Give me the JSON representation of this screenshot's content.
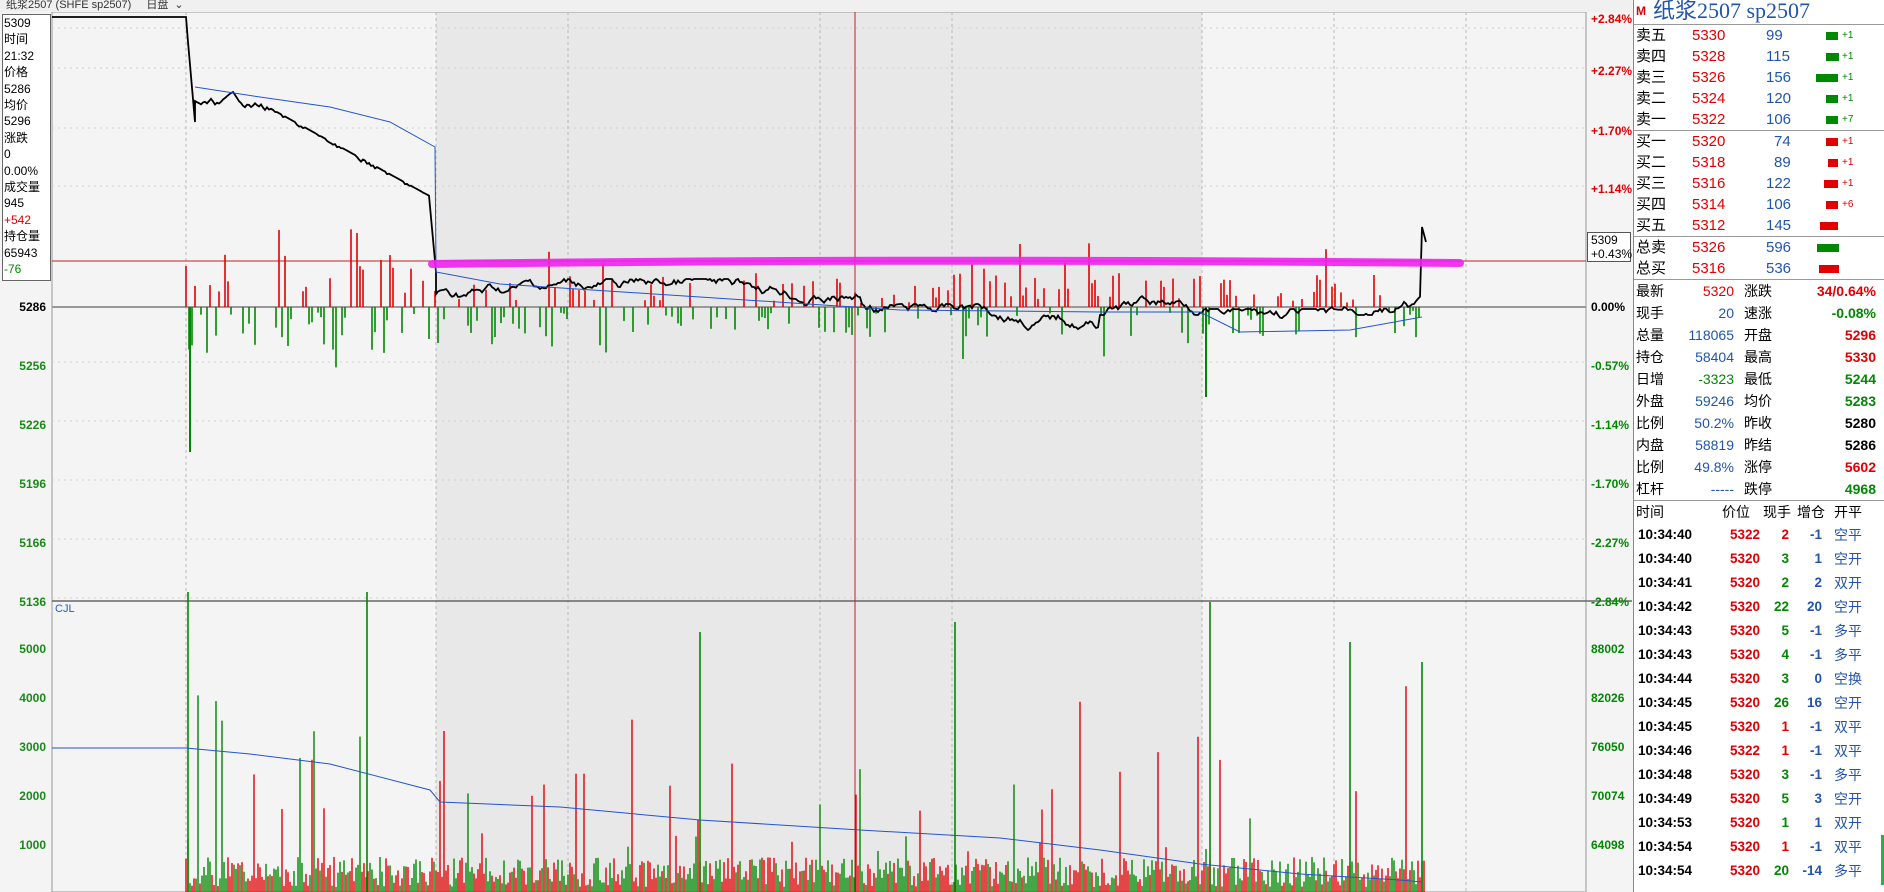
{
  "header": {
    "tab_text": "纸浆2507 (SHFE sp2507)",
    "period": "日盘"
  },
  "info_box": {
    "lines": [
      "5309",
      "时间",
      "21:32",
      "价格",
      "5286",
      "均价",
      "5296",
      "涨跌",
      "0",
      "0.00%",
      "成交量",
      "945",
      "+542",
      "持仓量",
      "65943",
      "-76"
    ]
  },
  "price_tag": {
    "price": "5309",
    "pct": "+0.43%"
  },
  "chart_axes": {
    "left_prices": [
      "5286",
      "5256",
      "5226",
      "5196",
      "5166",
      "5136"
    ],
    "right_pcts": [
      "+2.84%",
      "+2.27%",
      "+1.70%",
      "+1.14%",
      "0.00%",
      "-0.57%",
      "-1.14%",
      "-1.70%",
      "-2.27%",
      "-2.84%"
    ],
    "volume_left": [
      "5000",
      "4000",
      "3000",
      "2000",
      "1000"
    ],
    "volume_right": [
      "88002",
      "82026",
      "76050",
      "70074",
      "64098"
    ],
    "volume_label": "CJL"
  },
  "colors": {
    "up": "#e00000",
    "down": "#008800",
    "avg_line": "#2255cc",
    "highlight": "#ee22ee",
    "price_line": "#000000"
  },
  "quote_panel": {
    "marker": "M",
    "title": "纸浆2507  sp2507",
    "asks": [
      {
        "label": "卖五",
        "price": "5330",
        "vol": "99",
        "chg": "+1"
      },
      {
        "label": "卖四",
        "price": "5328",
        "vol": "115",
        "chg": "+1"
      },
      {
        "label": "卖三",
        "price": "5326",
        "vol": "156",
        "chg": "+1"
      },
      {
        "label": "卖二",
        "price": "5324",
        "vol": "120",
        "chg": "+1"
      },
      {
        "label": "卖一",
        "price": "5322",
        "vol": "106",
        "chg": "+7"
      }
    ],
    "bids": [
      {
        "label": "买一",
        "price": "5320",
        "vol": "74",
        "chg": "+1"
      },
      {
        "label": "买二",
        "price": "5318",
        "vol": "89",
        "chg": "+1"
      },
      {
        "label": "买三",
        "price": "5316",
        "vol": "122",
        "chg": "+1"
      },
      {
        "label": "买四",
        "price": "5314",
        "vol": "106",
        "chg": "+6"
      },
      {
        "label": "买五",
        "price": "5312",
        "vol": "145",
        "chg": ""
      }
    ],
    "totals": [
      {
        "label": "总卖",
        "price": "5326",
        "vol": "596"
      },
      {
        "label": "总买",
        "price": "5316",
        "vol": "536"
      }
    ],
    "stats": [
      {
        "l1": "最新",
        "v1": "5320",
        "l2": "涨跌",
        "v2": "34/0.64%"
      },
      {
        "l1": "现手",
        "v1": "20",
        "l2": "速涨",
        "v2": "-0.08%"
      },
      {
        "l1": "总量",
        "v1": "118065",
        "l2": "开盘",
        "v2": "5296"
      },
      {
        "l1": "持仓",
        "v1": "58404",
        "l2": "最高",
        "v2": "5330"
      },
      {
        "l1": "日增",
        "v1": "-3323",
        "l2": "最低",
        "v2": "5244"
      },
      {
        "l1": "外盘",
        "v1": "59246",
        "l2": "均价",
        "v2": "5283"
      },
      {
        "l1": "比例",
        "v1": "50.2%",
        "l2": "昨收",
        "v2": "5280"
      },
      {
        "l1": "内盘",
        "v1": "58819",
        "l2": "昨结",
        "v2": "5286"
      },
      {
        "l1": "比例",
        "v1": "49.8%",
        "l2": "涨停",
        "v2": "5602"
      },
      {
        "l1": "杠杆",
        "v1": "-----",
        "l2": "跌停",
        "v2": "4968"
      }
    ],
    "trades_header": [
      "时间",
      "价位",
      "现手",
      "增仓",
      "开平"
    ],
    "trades": [
      {
        "time": "10:34:40",
        "price": "5322",
        "qty": "2",
        "oi": "-1",
        "type": "空平"
      },
      {
        "time": "10:34:40",
        "price": "5320",
        "qty": "3",
        "oi": "1",
        "type": "空开"
      },
      {
        "time": "10:34:41",
        "price": "5320",
        "qty": "2",
        "oi": "2",
        "type": "双开"
      },
      {
        "time": "10:34:42",
        "price": "5320",
        "qty": "22",
        "oi": "20",
        "type": "空开"
      },
      {
        "time": "10:34:43",
        "price": "5320",
        "qty": "5",
        "oi": "-1",
        "type": "多平"
      },
      {
        "time": "10:34:43",
        "price": "5320",
        "qty": "4",
        "oi": "-1",
        "type": "多平"
      },
      {
        "time": "10:34:44",
        "price": "5320",
        "qty": "3",
        "oi": "0",
        "type": "空换"
      },
      {
        "time": "10:34:45",
        "price": "5320",
        "qty": "26",
        "oi": "16",
        "type": "空开"
      },
      {
        "time": "10:34:45",
        "price": "5320",
        "qty": "1",
        "oi": "-1",
        "type": "双平"
      },
      {
        "time": "10:34:46",
        "price": "5322",
        "qty": "1",
        "oi": "-1",
        "type": "双平"
      },
      {
        "time": "10:34:48",
        "price": "5320",
        "qty": "3",
        "oi": "-1",
        "type": "多平"
      },
      {
        "time": "10:34:49",
        "price": "5320",
        "qty": "5",
        "oi": "3",
        "type": "空开"
      },
      {
        "time": "10:34:53",
        "price": "5320",
        "qty": "1",
        "oi": "1",
        "type": "双开"
      },
      {
        "time": "10:34:54",
        "price": "5320",
        "qty": "1",
        "oi": "-1",
        "type": "双平"
      },
      {
        "time": "10:34:54",
        "price": "5320",
        "qty": "20",
        "oi": "-14",
        "type": "多平"
      }
    ]
  }
}
